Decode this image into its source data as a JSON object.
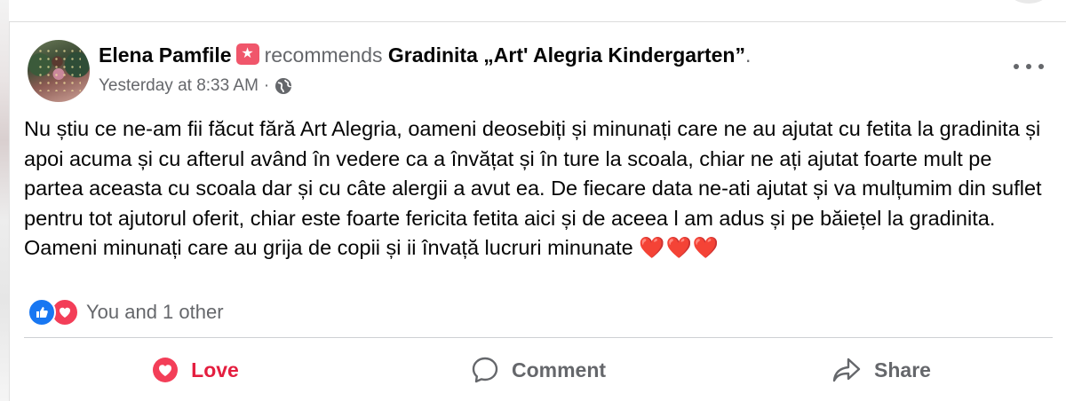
{
  "post": {
    "author": "Elena Pamfile",
    "verb": "recommends",
    "page_name": "Gradinita „Art' Alegria Kindergarten”",
    "trailing": ".",
    "timestamp": "Yesterday at 8:33 AM",
    "separator": "·",
    "privacy_icon": "globe-icon",
    "text": "Nu știu ce ne-am fii făcut fără Art Alegria, oameni deosebiți și minunați care ne au ajutat cu fetita la gradinita și apoi acuma și cu afterul având în vedere ca a învățat și în ture la scoala, chiar ne ați ajutat foarte mult pe partea aceasta cu scoala dar și cu câte alergii a avut ea. De fiecare data ne-ati ajutat și va mulțumim din suflet pentru tot ajutorul oferit, chiar este foarte fericita fetita aici și de aceea l am adus și pe băiețel la gradinita. Oameni minunați care au grija de copii și ii învață lucruri minunate",
    "emoji": "❤️❤️❤️"
  },
  "reactions": {
    "icons": [
      "like-icon",
      "love-icon"
    ],
    "summary": "You and 1 other"
  },
  "actions": {
    "love_label": "Love",
    "comment_label": "Comment",
    "share_label": "Share"
  },
  "colors": {
    "love_red": "#e41e3f",
    "like_blue": "#1877f2",
    "recommend_pink": "#f0566b",
    "secondary_text": "#65676b"
  }
}
